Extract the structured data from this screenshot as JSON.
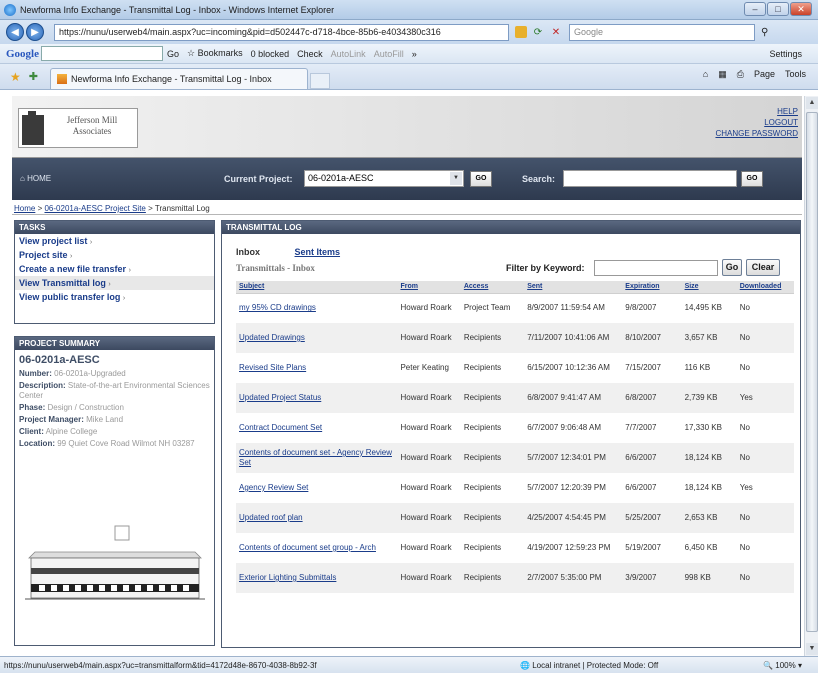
{
  "browser": {
    "title": "Newforma Info Exchange - Transmittal Log - Inbox - Windows Internet Explorer",
    "url": "https://nunu/userweb4/main.aspx?uc=incoming&pid=d502447c-d718-4bce-85b6-e4034380c316",
    "search_placeholder": "Google",
    "tab_title": "Newforma Info Exchange - Transmittal Log - Inbox",
    "toolbar": {
      "google": "Google",
      "go": "Go",
      "bookmarks": "Bookmarks",
      "blocked": "0 blocked",
      "check": "Check",
      "autolink": "AutoLink",
      "autofill": "AutoFill",
      "more": "»",
      "settings": "Settings"
    },
    "command_bar": {
      "page": "Page",
      "tools": "Tools"
    },
    "status": {
      "url": "https://nunu/userweb4/main.aspx?uc=transmittalform&tid=4172d48e-8670-4038-8b92-3f",
      "zone": "Local intranet | Protected Mode: Off",
      "zoom": "100%"
    }
  },
  "header": {
    "logo_text": "Jefferson Mill Associates",
    "links": [
      "HELP",
      "LOGOUT",
      "CHANGE PASSWORD"
    ]
  },
  "nav": {
    "home": "HOME",
    "current_project_label": "Current Project:",
    "current_project_value": "06-0201a-AESC",
    "go": "GO",
    "search_label": "Search:"
  },
  "breadcrumb": {
    "home": "Home",
    "sep": ">",
    "project_site": "06-0201a-AESC Project Site",
    "current": "Transmittal Log"
  },
  "tasks": {
    "title": "TASKS",
    "items": [
      "View project list",
      "Project site",
      "Create a new file transfer",
      "View Transmittal log",
      "View public transfer log"
    ]
  },
  "summary": {
    "title": "PROJECT SUMMARY",
    "project": "06-0201a-AESC",
    "number_label": "Number:",
    "number": "06-0201a-Upgraded",
    "description_label": "Description:",
    "description": "State-of-the-art Environmental Sciences Center",
    "phase_label": "Phase:",
    "phase": "Design / Construction",
    "pm_label": "Project Manager:",
    "pm": "Mike Land",
    "client_label": "Client:",
    "client": "Alpine College",
    "location_label": "Location:",
    "location": "99 Quiet Cove Road Wilmot NH 03287"
  },
  "transmittal": {
    "title": "TRANSMITTAL LOG",
    "tab_inbox": "Inbox",
    "tab_sent": "Sent Items",
    "subtitle": "Transmittals - Inbox",
    "filter_label": "Filter by Keyword:",
    "go": "Go",
    "clear": "Clear",
    "columns": [
      "Subject",
      "From",
      "Access",
      "Sent",
      "Expiration",
      "Size",
      "Downloaded"
    ],
    "rows": [
      {
        "subject": "my 95% CD drawings",
        "from": "Howard Roark",
        "access": "Project Team",
        "sent": "8/9/2007 11:59:54 AM",
        "expiration": "9/8/2007",
        "size": "14,495 KB",
        "downloaded": "No"
      },
      {
        "subject": "Updated Drawings",
        "from": "Howard Roark",
        "access": "Recipients",
        "sent": "7/11/2007 10:41:06 AM",
        "expiration": "8/10/2007",
        "size": "3,657 KB",
        "downloaded": "No"
      },
      {
        "subject": "Revised Site Plans",
        "from": "Peter Keating",
        "access": "Recipients",
        "sent": "6/15/2007 10:12:36 AM",
        "expiration": "7/15/2007",
        "size": "116 KB",
        "downloaded": "No"
      },
      {
        "subject": "Updated Project Status",
        "from": "Howard Roark",
        "access": "Recipients",
        "sent": "6/8/2007 9:41:47 AM",
        "expiration": "6/8/2007",
        "size": "2,739 KB",
        "downloaded": "Yes"
      },
      {
        "subject": "Contract Document Set",
        "from": "Howard Roark",
        "access": "Recipients",
        "sent": "6/7/2007 9:06:48 AM",
        "expiration": "7/7/2007",
        "size": "17,330 KB",
        "downloaded": "No"
      },
      {
        "subject": "Contents of document set - Agency Review Set",
        "from": "Howard Roark",
        "access": "Recipients",
        "sent": "5/7/2007 12:34:01 PM",
        "expiration": "6/6/2007",
        "size": "18,124 KB",
        "downloaded": "No"
      },
      {
        "subject": "Agency Review Set",
        "from": "Howard Roark",
        "access": "Recipients",
        "sent": "5/7/2007 12:20:39 PM",
        "expiration": "6/6/2007",
        "size": "18,124 KB",
        "downloaded": "Yes"
      },
      {
        "subject": "Updated roof plan",
        "from": "Howard Roark",
        "access": "Recipients",
        "sent": "4/25/2007 4:54:45 PM",
        "expiration": "5/25/2007",
        "size": "2,653 KB",
        "downloaded": "No"
      },
      {
        "subject": "Contents of document set group - Arch",
        "from": "Howard Roark",
        "access": "Recipients",
        "sent": "4/19/2007 12:59:23 PM",
        "expiration": "5/19/2007",
        "size": "6,450 KB",
        "downloaded": "No"
      },
      {
        "subject": "Exterior Lighting Submittals",
        "from": "Howard Roark",
        "access": "Recipients",
        "sent": "2/7/2007 5:35:00 PM",
        "expiration": "3/9/2007",
        "size": "998 KB",
        "downloaded": "No"
      }
    ]
  }
}
